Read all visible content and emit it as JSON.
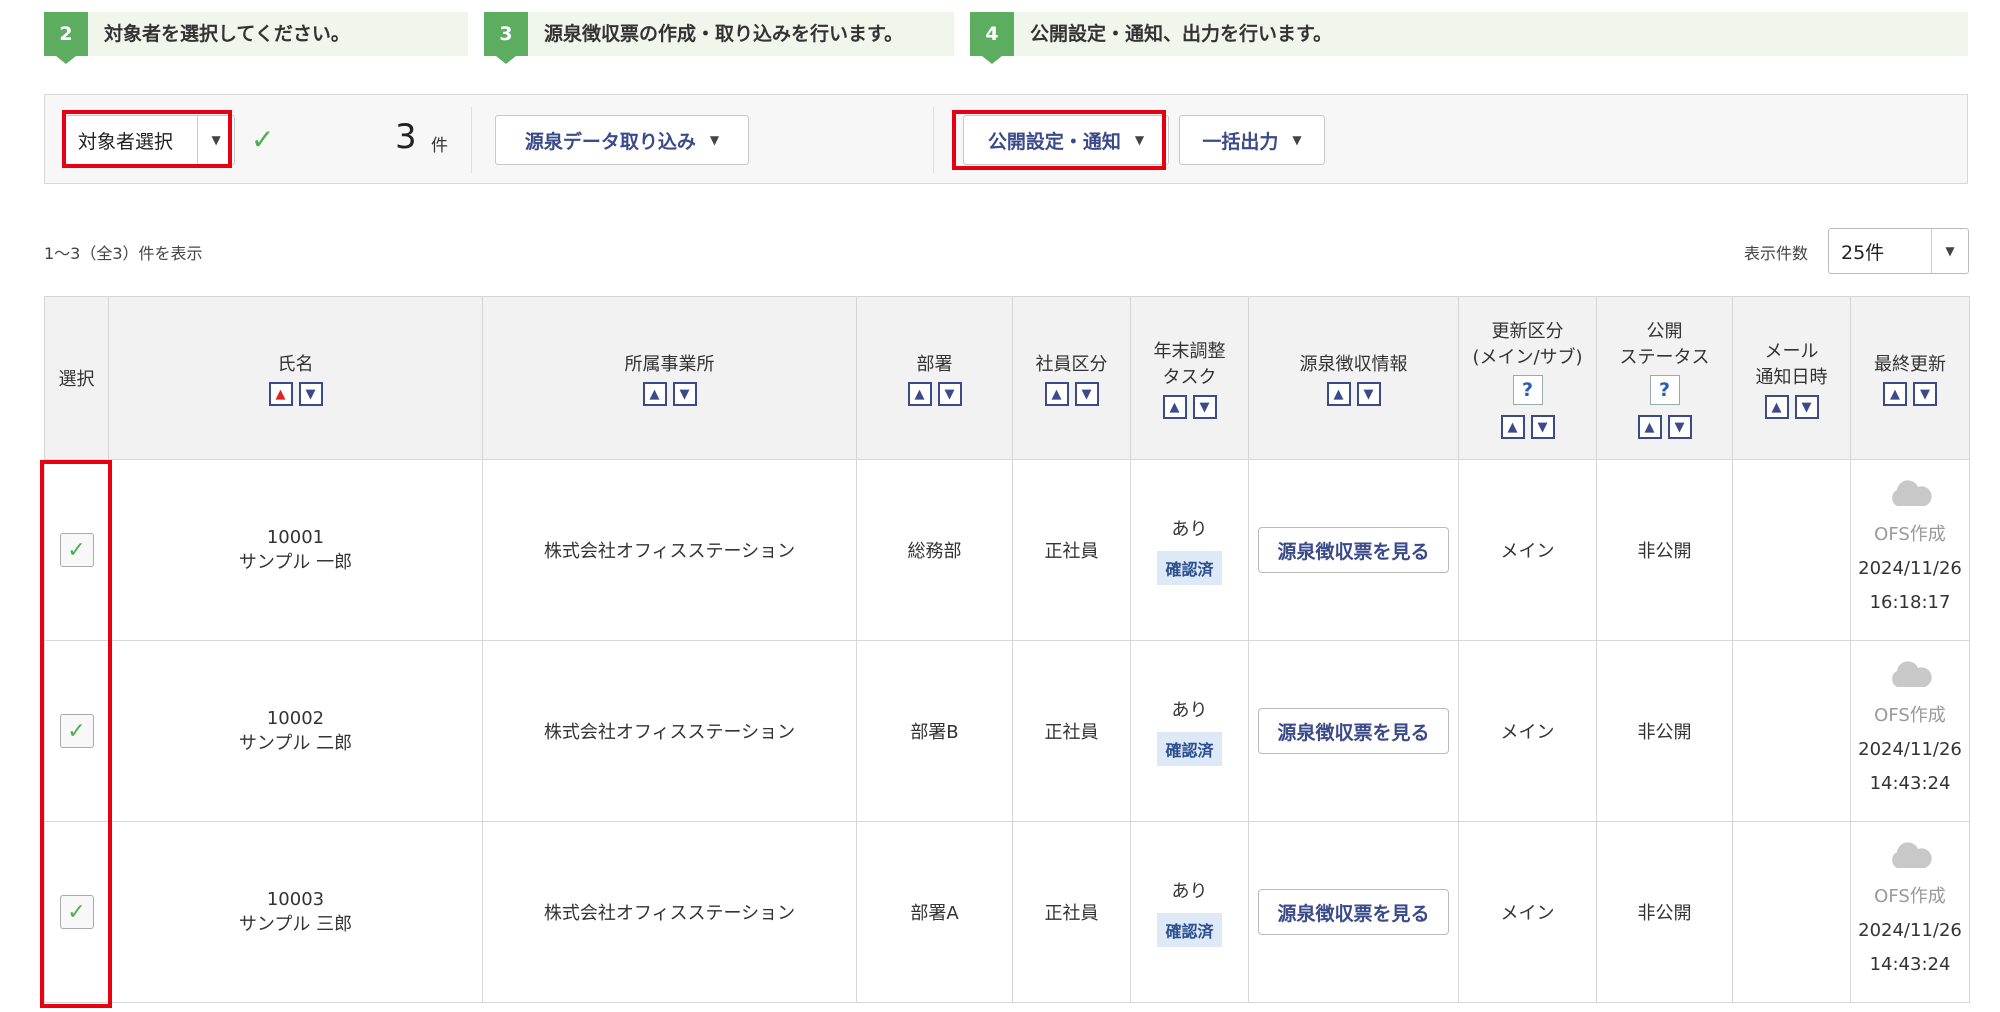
{
  "steps": [
    {
      "num": "2",
      "text": "対象者を選択してください。"
    },
    {
      "num": "3",
      "text": "源泉徴収票の作成・取り込みを行います。"
    },
    {
      "num": "4",
      "text": "公開設定・通知、出力を行います。"
    }
  ],
  "toolbar": {
    "select_label": "対象者選択",
    "count": "3",
    "count_unit": "件",
    "import_label": "源泉データ取り込み",
    "publish_label": "公開設定・通知",
    "export_label": "一括出力"
  },
  "summary": "1～3（全3）件を表示",
  "per_page": {
    "label": "表示件数",
    "value": "25件"
  },
  "table": {
    "headers": {
      "select": "選択",
      "name": "氏名",
      "office": "所属事業所",
      "dept": "部署",
      "emp_type": "社員区分",
      "yearend_1": "年末調整",
      "yearend_2": "タスク",
      "withholding": "源泉徴収情報",
      "update_1": "更新区分",
      "update_2": "(メイン/サブ)",
      "public_1": "公開",
      "public_2": "ステータス",
      "mail_1": "メール",
      "mail_2": "通知日時",
      "last_update": "最終更新"
    },
    "help_icon": "?",
    "rows": [
      {
        "id": "10001",
        "name": "サンプル 一郎",
        "office": "株式会社オフィスステーション",
        "dept": "総務部",
        "emp_type": "正社員",
        "yearend": "あり",
        "yearend_tag": "確認済",
        "view_label": "源泉徴収票を見る",
        "update": "メイン",
        "public": "非公開",
        "mail": "",
        "creator": "OFS作成",
        "date": "2024/11/26",
        "time": "16:18:17"
      },
      {
        "id": "10002",
        "name": "サンプル 二郎",
        "office": "株式会社オフィスステーション",
        "dept": "部署B",
        "emp_type": "正社員",
        "yearend": "あり",
        "yearend_tag": "確認済",
        "view_label": "源泉徴収票を見る",
        "update": "メイン",
        "public": "非公開",
        "mail": "",
        "creator": "OFS作成",
        "date": "2024/11/26",
        "time": "14:43:24"
      },
      {
        "id": "10003",
        "name": "サンプル 三郎",
        "office": "株式会社オフィスステーション",
        "dept": "部署A",
        "emp_type": "正社員",
        "yearend": "あり",
        "yearend_tag": "確認済",
        "view_label": "源泉徴収票を見る",
        "update": "メイン",
        "public": "非公開",
        "mail": "",
        "creator": "OFS作成",
        "date": "2024/11/26",
        "time": "14:43:24"
      }
    ]
  },
  "colors": {
    "accent_green": "#5cad5f",
    "highlight_red": "#e60012",
    "button_text": "#3a4a8a"
  },
  "icons": {
    "check": "check-icon",
    "caret": "caret-down-icon",
    "cloud": "cloud-icon",
    "sort_up": "sort-up-icon",
    "sort_down": "sort-down-icon",
    "help": "help-icon"
  }
}
